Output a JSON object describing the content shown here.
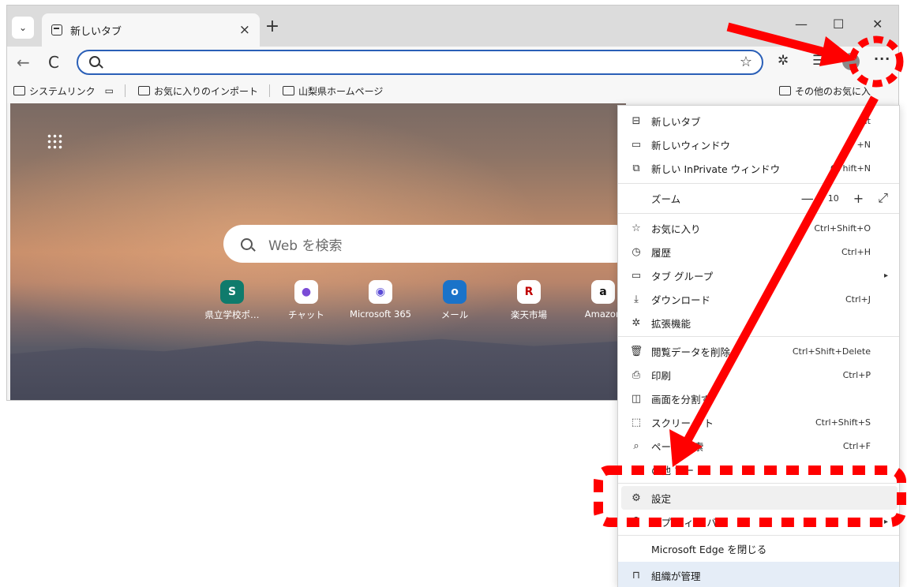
{
  "browser": {
    "tab_title": "新しいタブ",
    "tab_close": "×",
    "new_tab_symbol": "+",
    "win_min": "—",
    "win_max": "☐",
    "win_close": "✕",
    "back_symbol": "←",
    "refresh_symbol": "C",
    "more_symbol": "···"
  },
  "favorites": {
    "items": [
      "システムリンク",
      "お気に入りのインポート",
      "山梨県ホームページ"
    ],
    "other": "その他のお気に入"
  },
  "ntp": {
    "search_placeholder": "Web を検索",
    "tiles": [
      {
        "label": "県立学校ポ…",
        "glyph": "S",
        "color": "#0f7b6c"
      },
      {
        "label": "チャット",
        "glyph": "●",
        "color": "#ffffff"
      },
      {
        "label": "Microsoft 365",
        "glyph": "◉",
        "color": "#ffffff"
      },
      {
        "label": "メール",
        "glyph": "o",
        "color": "#0a66c2"
      },
      {
        "label": "楽天市場",
        "glyph": "R",
        "color": "#ffffff"
      },
      {
        "label": "Amazon",
        "glyph": "a",
        "color": "#ffffff"
      }
    ]
  },
  "menu": {
    "new_tab": {
      "label": "新しいタブ",
      "shortcut": "Ct"
    },
    "new_window": {
      "label": "新しいウィンドウ",
      "shortcut": "+N"
    },
    "new_inprivate": {
      "label": "新しい InPrivate ウィンドウ",
      "shortcut": "Ct    hift+N"
    },
    "zoom": {
      "label": "ズーム",
      "minus": "—",
      "value": "10",
      "plus": "+",
      "expand": "⤢"
    },
    "favorites": {
      "label": "お気に入り",
      "shortcut": "Ctrl+Shift+O"
    },
    "history": {
      "label": "履歴",
      "shortcut": "Ctrl+H"
    },
    "tab_groups": {
      "label": "タブ グループ",
      "arrow": "▸"
    },
    "downloads": {
      "label": "ダウンロード",
      "shortcut": "Ctrl+J"
    },
    "extensions": {
      "label": "拡張機能"
    },
    "clear_data": {
      "label": "閲覧データを削除",
      "shortcut": "Ctrl+Shift+Delete"
    },
    "print": {
      "label": "印刷",
      "shortcut": "Ctrl+P"
    },
    "split_screen": {
      "label": "画面を分割す"
    },
    "screenshot": {
      "label": "スクリー   ット",
      "shortcut": "Ctrl+Shift+S"
    },
    "find": {
      "label": "ページ内    索",
      "shortcut": "Ctrl+F"
    },
    "other_tools": {
      "label": "の他  ツー"
    },
    "settings": {
      "label": "設定"
    },
    "help": {
      "label": "ルプ  フィー   バ",
      "arrow": "▸"
    },
    "close_edge": {
      "label": "Microsoft Edge を閉じる"
    },
    "managed": {
      "label": "組織が管理"
    }
  },
  "annotation_color": "#ff0000"
}
